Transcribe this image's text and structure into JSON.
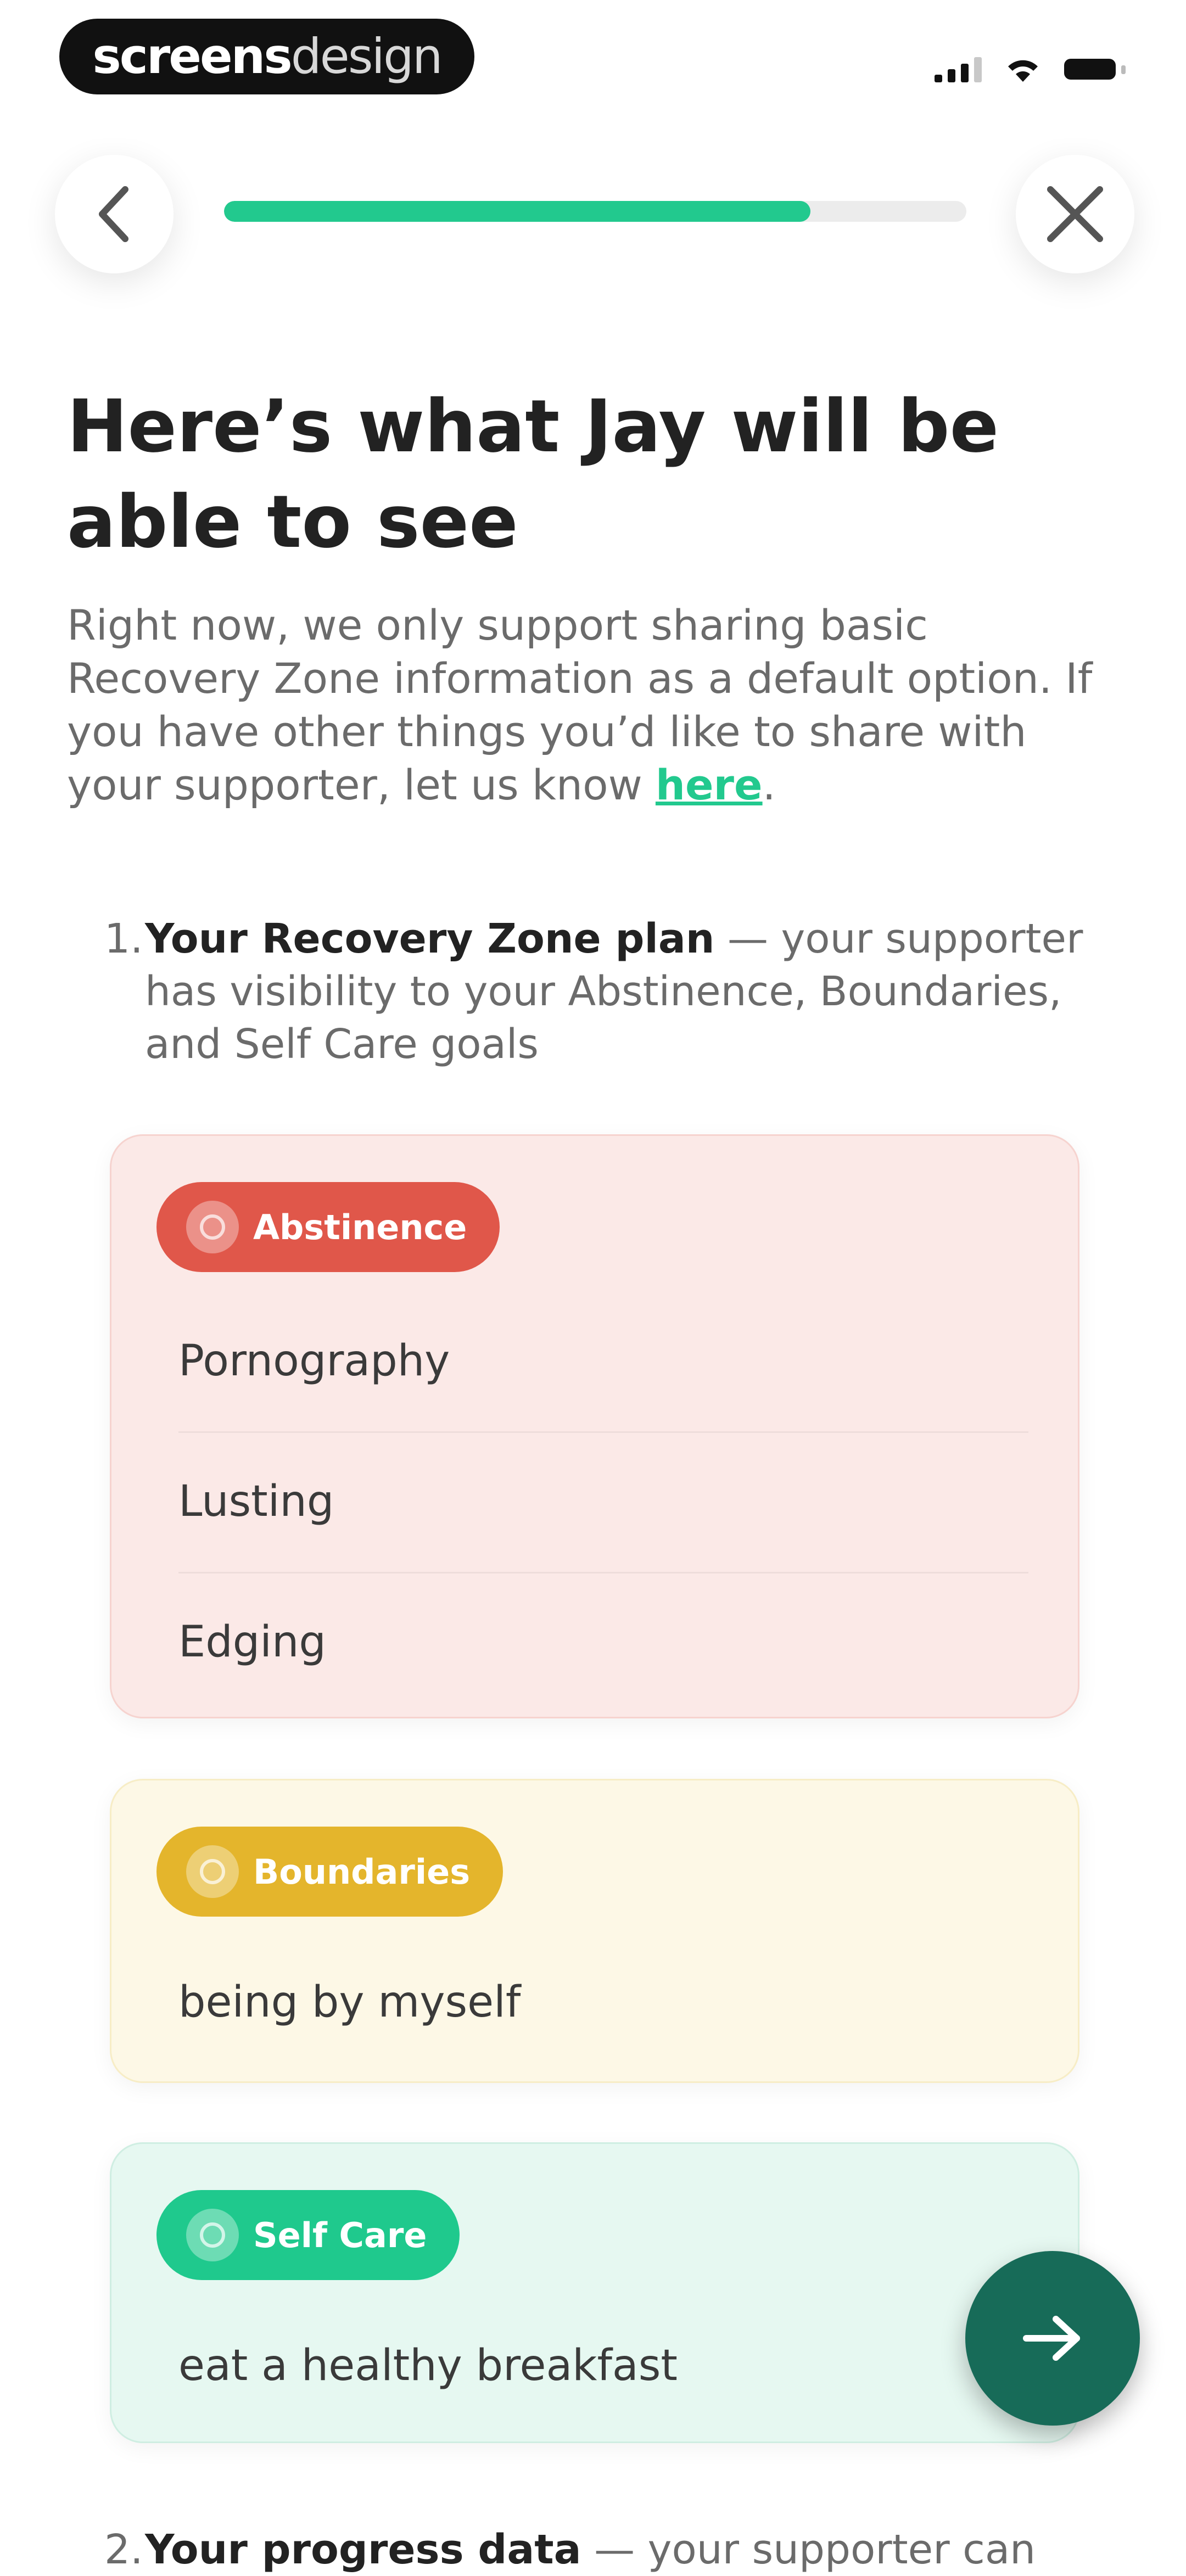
{
  "status_bar": {
    "brand_bold": "screens",
    "brand_light": "design"
  },
  "nav": {
    "back_icon": "chevron-left-icon",
    "close_icon": "close-icon",
    "progress_fraction": 0.79,
    "accent_color": "#22c98e"
  },
  "header": {
    "title": "Here’s what Jay will be able to see",
    "intro_text": "Right now, we only support sharing basic Recovery Zone information as a default option. If you have other things you’d like to share with your supporter, let us know ",
    "intro_link": "here",
    "intro_end": "."
  },
  "items": [
    {
      "number": "1.",
      "bold": "Your Recovery Zone plan",
      "text": " — your supporter has visibility to your Abstinence, Boundaries, and Self Care goals"
    },
    {
      "number": "2.",
      "bold": "Your progress data",
      "text": " — your supporter can"
    }
  ],
  "zones": {
    "abstinence": {
      "label": "Abstinence",
      "color": "#e0574a",
      "entries": [
        "Pornography",
        "Lusting",
        "Edging"
      ]
    },
    "boundaries": {
      "label": "Boundaries",
      "color": "#e4b52c",
      "entries": [
        "being by myself"
      ]
    },
    "self_care": {
      "label": "Self Care",
      "color": "#1fc98d",
      "entries": [
        "eat a healthy breakfast"
      ]
    }
  },
  "fab": {
    "icon": "arrow-right-icon",
    "color": "#176b58"
  }
}
